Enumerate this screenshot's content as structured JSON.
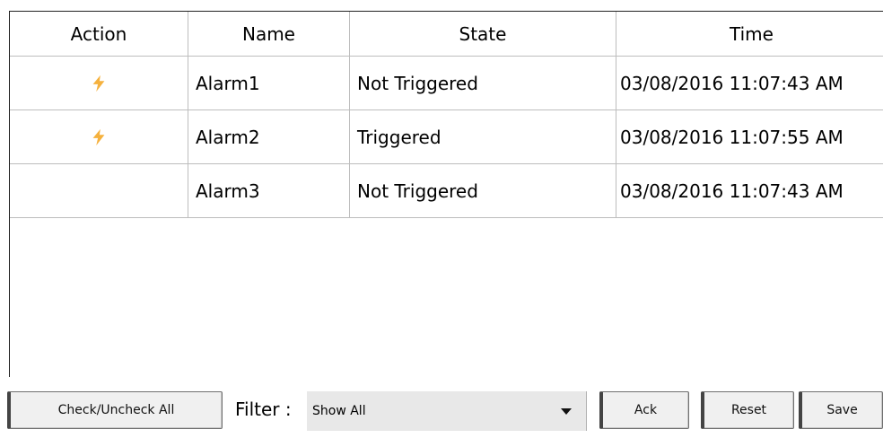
{
  "table": {
    "headers": {
      "action": "Action",
      "name": "Name",
      "state": "State",
      "time": "Time"
    },
    "rows": [
      {
        "action_icon": "lightning-icon",
        "name": "Alarm1",
        "state": "Not Triggered",
        "time": "03/08/2016 11:07:43 AM"
      },
      {
        "action_icon": "lightning-icon",
        "name": "Alarm2",
        "state": "Triggered",
        "time": "03/08/2016 11:07:55 AM"
      },
      {
        "action_icon": "",
        "name": "Alarm3",
        "state": "Not Triggered",
        "time": "03/08/2016 11:07:43 AM"
      }
    ]
  },
  "toolbar": {
    "check_all_label": "Check/Uncheck All",
    "filter_label": "Filter :",
    "filter_value": "Show All",
    "ack_label": "Ack",
    "reset_label": "Reset",
    "save_label": "Save"
  },
  "colors": {
    "bolt": "#f5b13d",
    "grid_line": "#bdbdbd"
  }
}
